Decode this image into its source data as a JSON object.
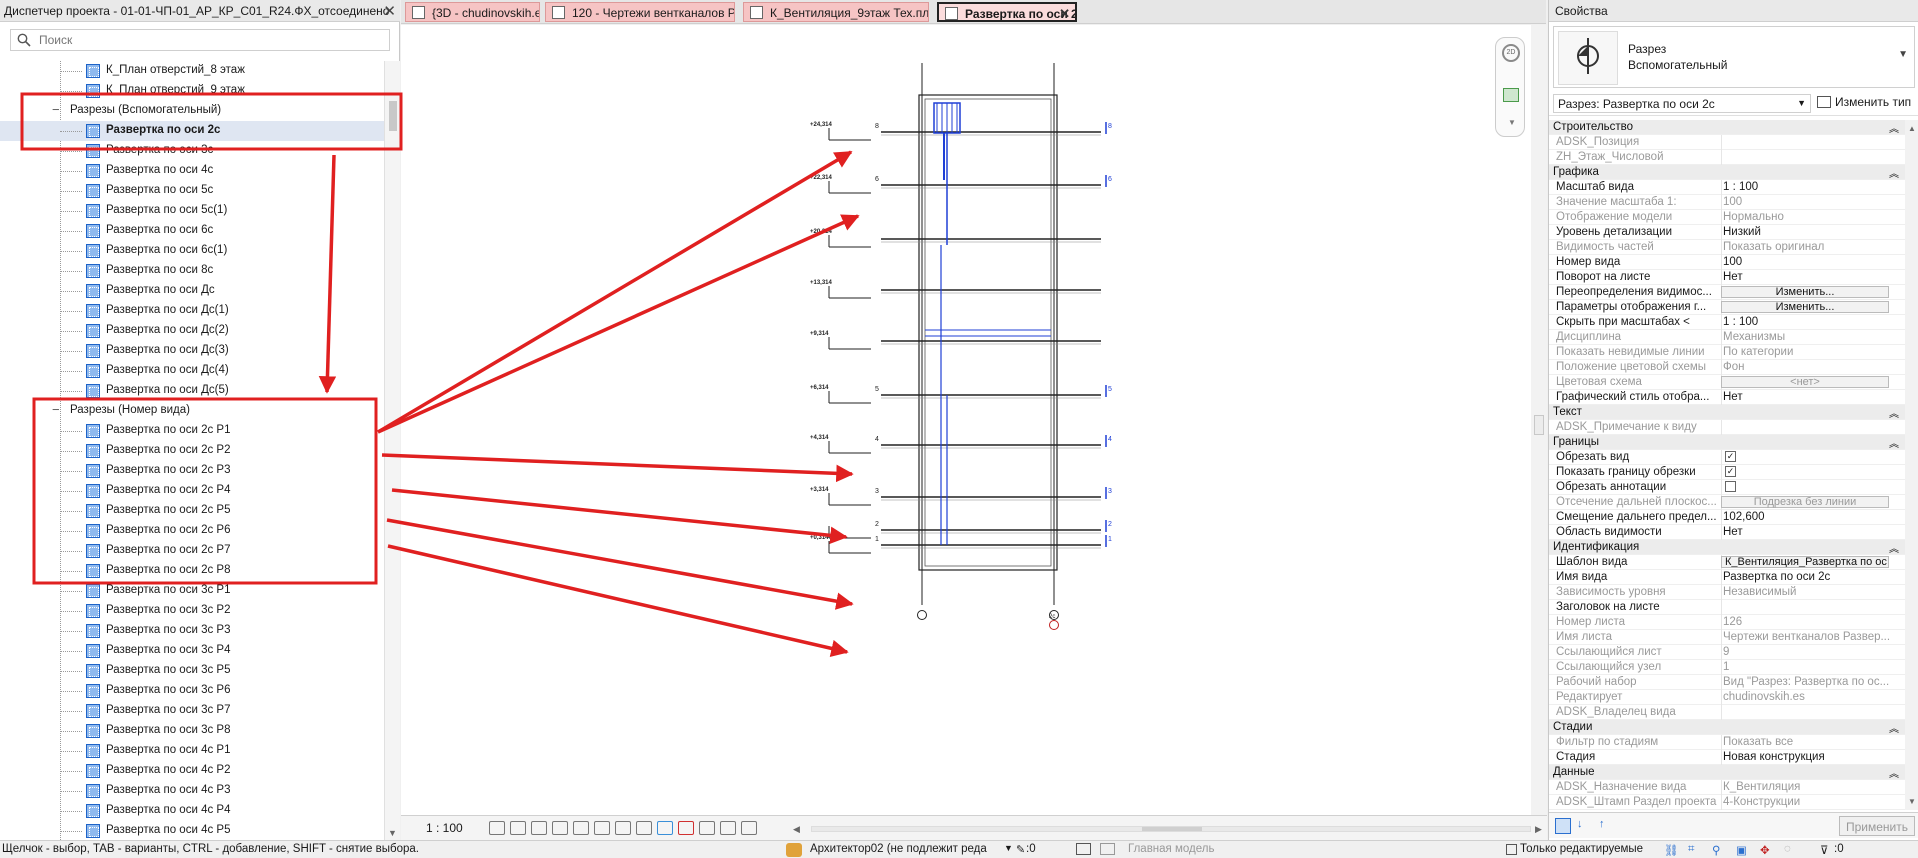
{
  "browser": {
    "title": "Диспетчер проекта - 01-01-ЧП-01_АР_КР_С01_R24.ФХ_отсоединено",
    "search_placeholder": "Поиск",
    "items": [
      {
        "label": "К_План отверстий_8 этаж",
        "kind": "view"
      },
      {
        "label": "К_План отверстий_9 этаж",
        "kind": "view"
      },
      {
        "label": "Разрезы (Вспомогательный)",
        "kind": "group"
      },
      {
        "label": "Развертка по оси 2с",
        "kind": "view",
        "selected": true
      },
      {
        "label": "Развертка по оси 3с",
        "kind": "view"
      },
      {
        "label": "Развертка по оси 4с",
        "kind": "view"
      },
      {
        "label": "Развертка по оси 5с",
        "kind": "view"
      },
      {
        "label": "Развертка по оси 5с(1)",
        "kind": "view"
      },
      {
        "label": "Развертка по оси 6с",
        "kind": "view"
      },
      {
        "label": "Развертка по оси 6с(1)",
        "kind": "view"
      },
      {
        "label": "Развертка по оси 8с",
        "kind": "view"
      },
      {
        "label": "Развертка по оси Дс",
        "kind": "view"
      },
      {
        "label": "Развертка по оси Дс(1)",
        "kind": "view"
      },
      {
        "label": "Развертка по оси Дс(2)",
        "kind": "view"
      },
      {
        "label": "Развертка по оси Дс(3)",
        "kind": "view"
      },
      {
        "label": "Развертка по оси Дс(4)",
        "kind": "view"
      },
      {
        "label": "Развертка по оси Дс(5)",
        "kind": "view"
      },
      {
        "label": "Разрезы (Номер вида)",
        "kind": "group"
      },
      {
        "label": "Развертка по оси 2с Р1",
        "kind": "view"
      },
      {
        "label": "Развертка по оси 2с Р2",
        "kind": "view"
      },
      {
        "label": "Развертка по оси 2с Р3",
        "kind": "view"
      },
      {
        "label": "Развертка по оси 2с Р4",
        "kind": "view"
      },
      {
        "label": "Развертка по оси 2с Р5",
        "kind": "view"
      },
      {
        "label": "Развертка по оси 2с Р6",
        "kind": "view"
      },
      {
        "label": "Развертка по оси 2с Р7",
        "kind": "view"
      },
      {
        "label": "Развертка по оси 2с Р8",
        "kind": "view"
      },
      {
        "label": "Развертка по оси 3с Р1",
        "kind": "view"
      },
      {
        "label": "Развертка по оси 3с Р2",
        "kind": "view"
      },
      {
        "label": "Развертка по оси 3с Р3",
        "kind": "view"
      },
      {
        "label": "Развертка по оси 3с Р4",
        "kind": "view"
      },
      {
        "label": "Развертка по оси 3с Р5",
        "kind": "view"
      },
      {
        "label": "Развертка по оси 3с Р6",
        "kind": "view"
      },
      {
        "label": "Развертка по оси 3с Р7",
        "kind": "view"
      },
      {
        "label": "Развертка по оси 3с Р8",
        "kind": "view"
      },
      {
        "label": "Развертка по оси 4с Р1",
        "kind": "view"
      },
      {
        "label": "Развертка по оси 4с Р2",
        "kind": "view"
      },
      {
        "label": "Развертка по оси 4с Р3",
        "kind": "view"
      },
      {
        "label": "Развертка по оси 4с Р4",
        "kind": "view"
      },
      {
        "label": "Развертка по оси 4с Р5",
        "kind": "view"
      }
    ]
  },
  "tabs": [
    {
      "label": "{3D - chudinovskih.es}",
      "active": false
    },
    {
      "label": "120 - Чертежи вентканалов Разве...",
      "active": false
    },
    {
      "label": "К_Вентиляция_9этаж Тех.план",
      "active": false
    },
    {
      "label": "Развертка по оси 2с",
      "active": true
    }
  ],
  "drawing": {
    "levels": [
      {
        "mark": "8",
        "elev": "+24,314"
      },
      {
        "mark": "6",
        "elev": "+22,314"
      },
      {
        "mark": "",
        "elev": "+20,314"
      },
      {
        "mark": "",
        "elev": "+13,314"
      },
      {
        "mark": "",
        "elev": "+9,314"
      },
      {
        "mark": "5",
        "elev": "+6,314"
      },
      {
        "mark": "4",
        "elev": "+4,314"
      },
      {
        "mark": "3",
        "elev": "+3,314"
      },
      {
        "mark": "2",
        "elev": ""
      },
      {
        "mark": "1",
        "elev": "+0,314"
      }
    ],
    "view_cube_label": "2D",
    "grid_bubble_label": "2с"
  },
  "vcb": {
    "scale": "1 : 100"
  },
  "props": {
    "title": "Свойства",
    "family_line1": "Разрез",
    "family_line2": "Вспомогательный",
    "instance_selector": "Разрез: Развертка по оси 2с",
    "edit_type": "Изменить тип",
    "apply": "Применить",
    "rows": [
      {
        "t": "section",
        "n": "Строительство"
      },
      {
        "t": "ro",
        "n": "ADSK_Позиция",
        "v": ""
      },
      {
        "t": "ro",
        "n": "ZH_Этаж_Числовой",
        "v": ""
      },
      {
        "t": "section",
        "n": "Графика"
      },
      {
        "t": "rw",
        "n": "Масштаб вида",
        "v": "1 : 100"
      },
      {
        "t": "ro",
        "n": "Значение масштаба    1:",
        "v": "100"
      },
      {
        "t": "ro",
        "n": "Отображение модели",
        "v": "Нормально"
      },
      {
        "t": "rw",
        "n": "Уровень детализации",
        "v": "Низкий"
      },
      {
        "t": "ro",
        "n": "Видимость частей",
        "v": "Показать оригинал"
      },
      {
        "t": "rw",
        "n": "Номер вида",
        "v": "100"
      },
      {
        "t": "rw",
        "n": "Поворот на листе",
        "v": "Нет"
      },
      {
        "t": "btn",
        "n": "Переопределения видимос...",
        "v": "Изменить..."
      },
      {
        "t": "btn",
        "n": "Параметры отображения г...",
        "v": "Изменить..."
      },
      {
        "t": "rw",
        "n": "Скрыть при масштабах <",
        "v": "1 : 100"
      },
      {
        "t": "ro",
        "n": "Дисциплина",
        "v": "Механизмы"
      },
      {
        "t": "ro",
        "n": "Показать невидимые линии",
        "v": "По категории"
      },
      {
        "t": "ro",
        "n": "Положение цветовой схемы",
        "v": "Фон"
      },
      {
        "t": "robtn",
        "n": "Цветовая схема",
        "v": "<нет>"
      },
      {
        "t": "rw",
        "n": "Графический стиль отобра...",
        "v": "Нет"
      },
      {
        "t": "section",
        "n": "Текст"
      },
      {
        "t": "ro",
        "n": "ADSK_Примечание к виду",
        "v": ""
      },
      {
        "t": "section",
        "n": "Границы"
      },
      {
        "t": "cb",
        "n": "Обрезать вид",
        "v": "✓"
      },
      {
        "t": "cb",
        "n": "Показать границу обрезки",
        "v": "✓"
      },
      {
        "t": "cb",
        "n": "Обрезать аннотации",
        "v": ""
      },
      {
        "t": "robtn",
        "n": "Отсечение дальней плоскос...",
        "v": "Подрезка без линии"
      },
      {
        "t": "rw",
        "n": "Смещение дальнего предел...",
        "v": "102,600"
      },
      {
        "t": "rw",
        "n": "Область видимости",
        "v": "Нет"
      },
      {
        "t": "section",
        "n": "Идентификация"
      },
      {
        "t": "rwb",
        "n": "Шаблон вида",
        "v": "К_Вентиляция_Развертка по ос"
      },
      {
        "t": "rw",
        "n": "Имя вида",
        "v": "Развертка по оси 2с"
      },
      {
        "t": "ro",
        "n": "Зависимость уровня",
        "v": "Независимый"
      },
      {
        "t": "rw",
        "n": "Заголовок на листе",
        "v": ""
      },
      {
        "t": "ro",
        "n": "Номер листа",
        "v": "126"
      },
      {
        "t": "ro",
        "n": "Имя листа",
        "v": "Чертежи вентканалов Развер..."
      },
      {
        "t": "ro",
        "n": "Ссылающийся лист",
        "v": "9"
      },
      {
        "t": "ro",
        "n": "Ссылающийся узел",
        "v": "1"
      },
      {
        "t": "ro",
        "n": "Рабочий набор",
        "v": "Вид \"Разрез: Развертка по ос..."
      },
      {
        "t": "ro",
        "n": "Редактирует",
        "v": "chudinovskih.es"
      },
      {
        "t": "ro",
        "n": "ADSK_Владелец вида",
        "v": ""
      },
      {
        "t": "section",
        "n": "Стадии"
      },
      {
        "t": "ro",
        "n": "Фильтр по стадиям",
        "v": "Показать все"
      },
      {
        "t": "rw",
        "n": "Стадия",
        "v": "Новая конструкция"
      },
      {
        "t": "section",
        "n": "Данные"
      },
      {
        "t": "ro",
        "n": "ADSK_Назначение вида",
        "v": "К_Вентиляция"
      },
      {
        "t": "ro",
        "n": "ADSK_Штамп Раздел проекта",
        "v": "4-Конструкции"
      }
    ]
  },
  "status": {
    "hint": "Щелчок - выбор, TAB - варианты, CTRL - добавление, SHIFT - снятие выбора.",
    "workset": "Архитектор02 (не подлежит реда",
    "workset_count": ":0",
    "design_option": "Главная модель",
    "editable_only": "Только редактируемые",
    "filter_count": ":0"
  },
  "colors": {
    "annotation_red": "#e02020",
    "model_blue": "#1f3fd6",
    "tab_pink": "#f6c4c4"
  }
}
